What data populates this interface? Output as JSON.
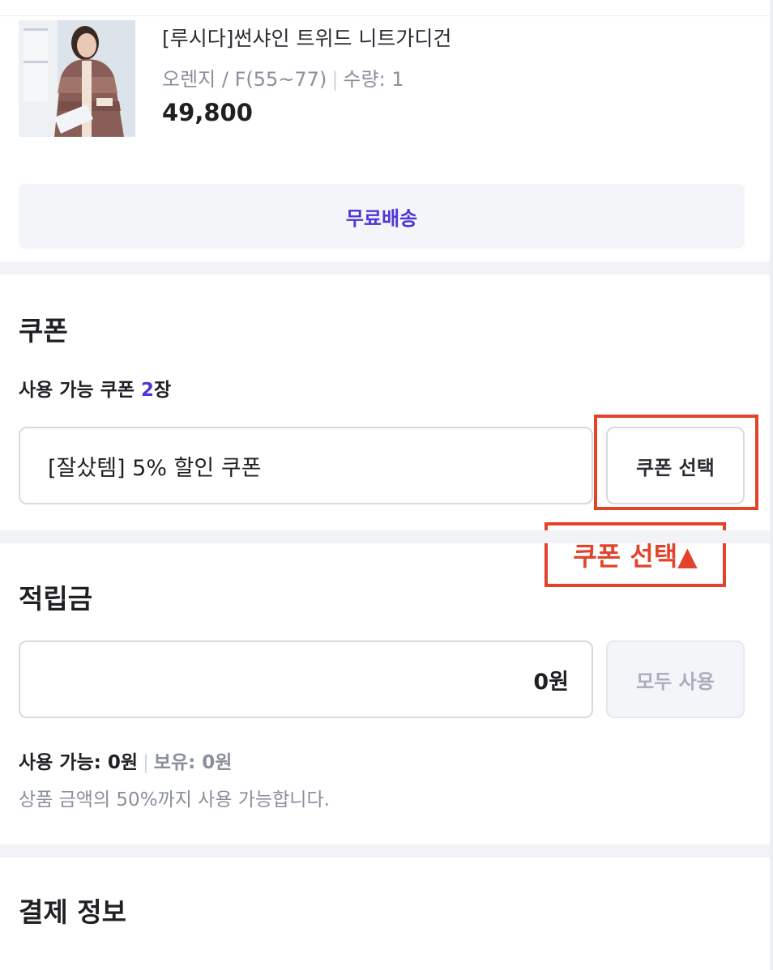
{
  "product": {
    "name": "[루시다]썬샤인 트위드 니트가디건",
    "option": "오렌지 / F(55~77)",
    "quantity": "수량: 1",
    "price": "49,800",
    "image_icon": "cardigan-photo"
  },
  "shipping": {
    "label": "무료배송"
  },
  "coupon": {
    "title": "쿠폰",
    "available_prefix": "사용 가능 쿠폰 ",
    "available_count": "2",
    "available_suffix": "장",
    "selected": "[잘샀템] 5% 할인 쿠폰",
    "button": "쿠폰 선택"
  },
  "annotation": {
    "label": "쿠폰 선택▲",
    "color": "#e3432b"
  },
  "points": {
    "title": "적립금",
    "value": "0원",
    "button": "모두 사용",
    "available": "사용 가능: 0원",
    "held": "보유: 0원",
    "note": "상품 금액의 50%까지 사용 가능합니다."
  },
  "payment": {
    "title": "결제 정보"
  },
  "colors": {
    "accent": "#4d36d9",
    "muted": "#8a8f9c",
    "border": "#d7dae1"
  }
}
